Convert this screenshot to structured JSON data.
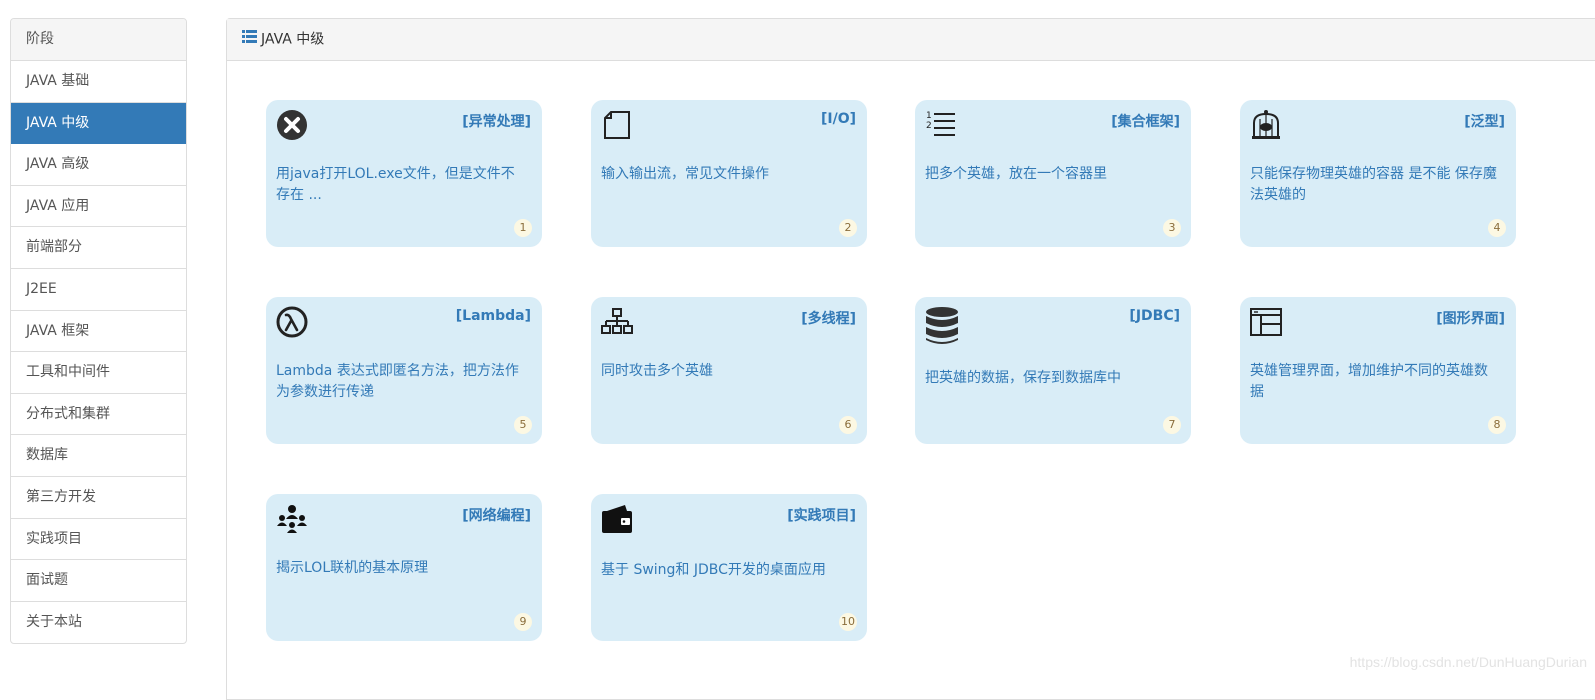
{
  "sidebar": {
    "header": "阶段",
    "items": [
      {
        "label": "JAVA 基础",
        "active": false
      },
      {
        "label": "JAVA 中级",
        "active": true
      },
      {
        "label": "JAVA 高级",
        "active": false
      },
      {
        "label": "JAVA 应用",
        "active": false
      },
      {
        "label": "前端部分",
        "active": false
      },
      {
        "label": "J2EE",
        "active": false
      },
      {
        "label": "JAVA 框架",
        "active": false
      },
      {
        "label": "工具和中间件",
        "active": false
      },
      {
        "label": "分布式和集群",
        "active": false
      },
      {
        "label": "数据库",
        "active": false
      },
      {
        "label": "第三方开发",
        "active": false
      },
      {
        "label": "实践项目",
        "active": false
      },
      {
        "label": "面试题",
        "active": false
      },
      {
        "label": "关于本站",
        "active": false
      }
    ]
  },
  "panel": {
    "title": "JAVA 中级",
    "icon": "list-icon"
  },
  "cards": [
    {
      "title": "[异常处理]",
      "desc": "用java打开LOL.exe文件，但是文件不存在 ...",
      "badge": "1",
      "icon": "circle-x-icon"
    },
    {
      "title": "[I/O]",
      "desc": "输入输出流，常见文件操作",
      "badge": "2",
      "icon": "file-icon"
    },
    {
      "title": "[集合框架]",
      "desc": "把多个英雄，放在一个容器里",
      "badge": "3",
      "icon": "ordered-list-icon"
    },
    {
      "title": "[泛型]",
      "desc": "只能保存物理英雄的容器 是不能 保存魔法英雄的",
      "badge": "4",
      "icon": "birdcage-icon"
    },
    {
      "title": "[Lambda]",
      "desc": "Lambda 表达式即匿名方法，把方法作为参数进行传递",
      "badge": "5",
      "icon": "lambda-icon"
    },
    {
      "title": "[多线程]",
      "desc": "同时攻击多个英雄",
      "badge": "6",
      "icon": "sitemap-icon"
    },
    {
      "title": "[JDBC]",
      "desc": "把英雄的数据，保存到数据库中",
      "badge": "7",
      "icon": "database-icon"
    },
    {
      "title": "[图形界面]",
      "desc": "英雄管理界面，增加维护不同的英雄数据",
      "badge": "8",
      "icon": "window-layout-icon"
    },
    {
      "title": "[网络编程]",
      "desc": "揭示LOL联机的基本原理",
      "badge": "9",
      "icon": "network-users-icon"
    },
    {
      "title": "[实践项目]",
      "desc": "基于 Swing和 JDBC开发的桌面应用",
      "badge": "10",
      "icon": "wallet-icon"
    }
  ],
  "watermark": "https://blog.csdn.net/DunHuangDurian",
  "colors": {
    "accent": "#337ab7",
    "card_bg": "#d9edf7",
    "badge_bg": "#fcf8e3",
    "badge_text": "#8a6d3b"
  }
}
